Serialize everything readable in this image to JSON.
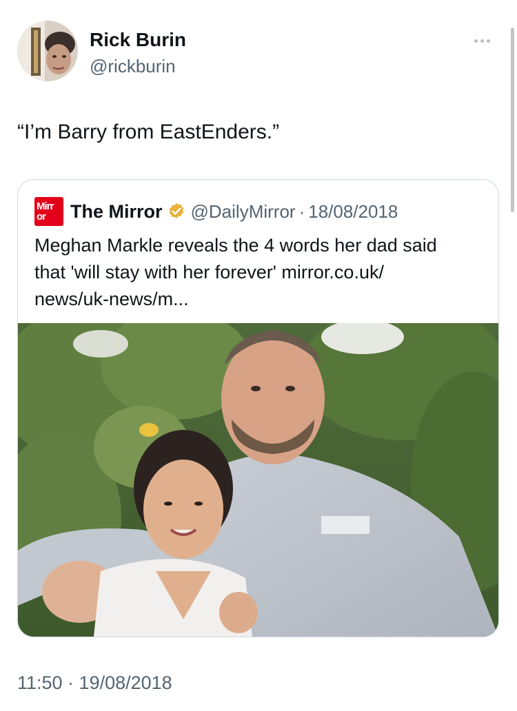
{
  "author": {
    "display_name": "Rick Burin",
    "handle": "@rickburin",
    "avatar_icon": "profile-photo"
  },
  "menu": {
    "icon": "more-horizontal-icon"
  },
  "tweet": {
    "text": "“I’m Barry from EastEnders.”",
    "timestamp": "11:50 · 19/08/2018"
  },
  "quoted_tweet": {
    "logo_line1": "Mirr",
    "logo_line2": "or",
    "display_name": "The Mirror",
    "verified_icon": "verified-gold-badge-icon",
    "handle": "@DailyMirror",
    "separator": "·",
    "date": "18/08/2018",
    "text_lines": [
      "Meghan Markle reveals the 4 words her dad said",
      "that 'will stay with her forever' mirror.co.uk/",
      "news/uk-news/m..."
    ],
    "photo_icon": "news-photo"
  },
  "colors": {
    "text_primary": "#0f1419",
    "text_secondary": "#536471",
    "border": "#cfd9de",
    "mirror_red": "#e2001a",
    "verified_gold": "#e8b23a"
  }
}
